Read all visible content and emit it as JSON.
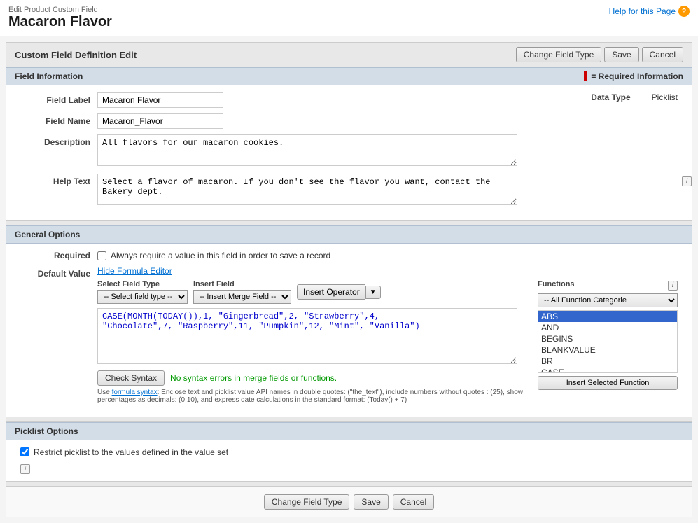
{
  "page": {
    "edit_label": "Edit Product Custom Field",
    "title": "Macaron Flavor",
    "help_link": "Help for this Page"
  },
  "header": {
    "section_title": "Custom Field Definition Edit",
    "change_field_type_btn": "Change Field Type",
    "save_btn": "Save",
    "cancel_btn": "Cancel"
  },
  "field_info": {
    "section_title": "Field Information",
    "required_legend": "= Required Information",
    "field_label_label": "Field Label",
    "field_label_value": "Macaron Flavor",
    "field_name_label": "Field Name",
    "field_name_value": "Macaron_Flavor",
    "data_type_label": "Data Type",
    "data_type_value": "Picklist",
    "description_label": "Description",
    "description_value": "All flavors for our macaron cookies.",
    "help_text_label": "Help Text",
    "help_text_value": "Select a flavor of macaron. If you don't see the flavor you want, contact the Bakery dept."
  },
  "general_options": {
    "section_title": "General Options",
    "required_label": "Required",
    "required_checkbox_label": "Always require a value in this field in order to save a record",
    "default_value_label": "Default Value",
    "hide_formula_link": "Hide Formula Editor",
    "select_field_type_label": "Select Field Type",
    "select_field_type_placeholder": "-- Select field type --",
    "insert_field_label": "Insert Field",
    "insert_field_placeholder": "-- Insert Merge Field --",
    "insert_operator_btn": "Insert Operator",
    "functions_label": "Functions",
    "functions_category_placeholder": "-- All Function Categorie",
    "functions_info_icon": "i",
    "functions_list": [
      "ABS",
      "AND",
      "BEGINS",
      "BLANKVALUE",
      "BR",
      "CASE"
    ],
    "selected_function": "ABS",
    "insert_selected_function_btn": "Insert Selected Function",
    "formula_value": "CASE(MONTH(TODAY()),1, \"Gingerbread\",2, \"Strawberry\",4,\n\"Chocolate\",7, \"Raspberry\",11, \"Pumpkin\",12, \"Mint\", \"Vanilla\")",
    "check_syntax_btn": "Check Syntax",
    "no_error_msg": "No syntax errors in merge fields or functions.",
    "formula_hint": "Use formula syntax: Enclose text and picklist value API names in double quotes: (\"the_text\"), include numbers without quotes : (25), show percentages as decimals: (0.10), and express date calculations in the standard format: (Today() + 7)",
    "formula_syntax_link": "formula syntax"
  },
  "picklist_options": {
    "section_title": "Picklist Options",
    "restrict_checkbox_label": "Restrict picklist to the values defined in the value set",
    "info_icon": "i"
  },
  "bottom": {
    "change_field_type_btn": "Change Field Type",
    "save_btn": "Save",
    "cancel_btn": "Cancel"
  }
}
